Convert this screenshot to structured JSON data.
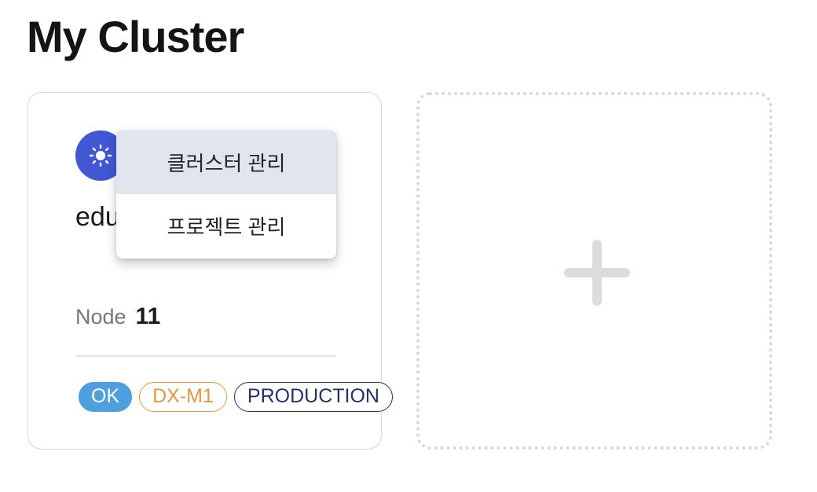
{
  "page": {
    "title": "My Cluster"
  },
  "cluster_card": {
    "avatar_icon": "sun-icon",
    "avatar_color": "#4257d4",
    "name": "edu",
    "node_label": "Node",
    "node_count": "11",
    "tags": {
      "status": "OK",
      "region": "DX-M1",
      "environment": "PRODUCTION"
    },
    "tag_colors": {
      "status": "#4d9fde",
      "region": "#e6963f",
      "environment": "#24306c"
    }
  },
  "context_menu": {
    "items": [
      {
        "label": "클러스터 관리",
        "active": true
      },
      {
        "label": "프로젝트 관리",
        "active": false
      }
    ]
  },
  "add_card": {
    "icon": "plus-icon"
  }
}
